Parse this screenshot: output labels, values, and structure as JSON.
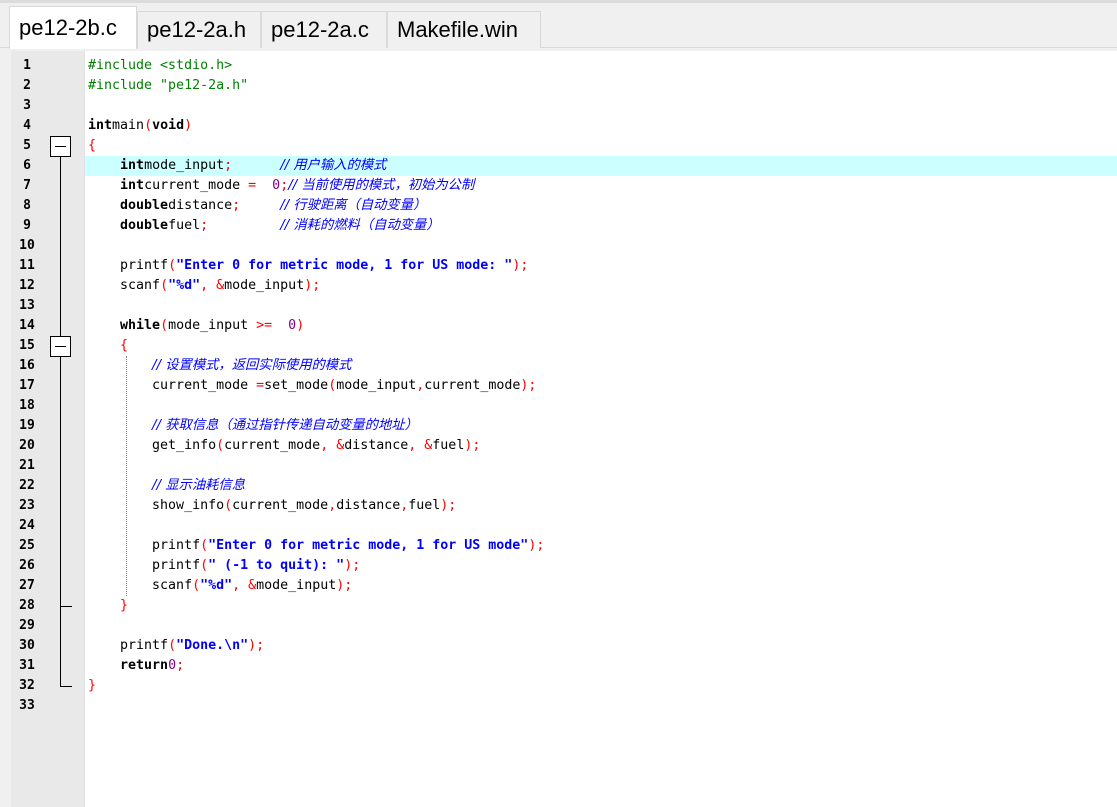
{
  "tabs": [
    {
      "label": "pe12-2b.c",
      "active": true
    },
    {
      "label": "pe12-2a.h",
      "active": false
    },
    {
      "label": "pe12-2a.c",
      "active": false
    },
    {
      "label": "Makefile.win",
      "active": false
    }
  ],
  "editor": {
    "current_line": 6,
    "fold_markers": [
      5,
      15
    ],
    "lines": [
      [
        [
          "pp",
          "#include <stdio.h>"
        ]
      ],
      [
        [
          "pp",
          "#include \"pe12-2a.h\""
        ]
      ],
      [],
      [
        [
          "kw",
          "int"
        ],
        [
          "",
          "main"
        ],
        [
          "sym",
          "("
        ],
        [
          "kw",
          "void"
        ],
        [
          "sym",
          ")"
        ]
      ],
      [
        [
          "sym",
          "{"
        ]
      ],
      [
        [
          "",
          "    "
        ],
        [
          "kw",
          "int"
        ],
        [
          "",
          "mode_input"
        ],
        [
          "sym",
          ";"
        ],
        [
          "",
          "      "
        ],
        [
          "cm",
          "// 用户输入的模式"
        ]
      ],
      [
        [
          "",
          "    "
        ],
        [
          "kw",
          "int"
        ],
        [
          "",
          "current_mode "
        ],
        [
          "sym",
          "="
        ],
        [
          "",
          "  "
        ],
        [
          "num",
          "0"
        ],
        [
          "sym",
          ";"
        ],
        [
          "",
          ""
        ],
        [
          "cm",
          "// 当前使用的模式，初始为公制"
        ]
      ],
      [
        [
          "",
          "    "
        ],
        [
          "kw",
          "double"
        ],
        [
          "",
          "distance"
        ],
        [
          "sym",
          ";"
        ],
        [
          "",
          "     "
        ],
        [
          "cm",
          "// 行驶距离（自动变量）"
        ]
      ],
      [
        [
          "",
          "    "
        ],
        [
          "kw",
          "double"
        ],
        [
          "",
          "fuel"
        ],
        [
          "sym",
          ";"
        ],
        [
          "",
          "         "
        ],
        [
          "cm",
          "// 消耗的燃料（自动变量）"
        ]
      ],
      [],
      [
        [
          "",
          "    printf"
        ],
        [
          "sym",
          "("
        ],
        [
          "str",
          "\"Enter 0 for metric mode, 1 for US mode: \""
        ],
        [
          "sym",
          ");"
        ]
      ],
      [
        [
          "",
          "    scanf"
        ],
        [
          "sym",
          "("
        ],
        [
          "str",
          "\"%d\""
        ],
        [
          "sym",
          ", &"
        ],
        [
          "",
          "mode_input"
        ],
        [
          "sym",
          ");"
        ]
      ],
      [],
      [
        [
          "",
          "    "
        ],
        [
          "kw",
          "while"
        ],
        [
          "",
          ""
        ],
        [
          "sym",
          "("
        ],
        [
          "",
          "mode_input "
        ],
        [
          "sym",
          ">="
        ],
        [
          "",
          "  "
        ],
        [
          "num",
          "0"
        ],
        [
          "sym",
          ")"
        ]
      ],
      [
        [
          "",
          "    "
        ],
        [
          "sym",
          "{"
        ]
      ],
      [
        [
          "",
          "        "
        ],
        [
          "cm",
          "// 设置模式，返回实际使用的模式"
        ]
      ],
      [
        [
          "",
          "        current_mode "
        ],
        [
          "sym",
          "="
        ],
        [
          "",
          ""
        ],
        [
          "",
          "set_mode"
        ],
        [
          "sym",
          "("
        ],
        [
          "",
          "mode_input"
        ],
        [
          "sym",
          ","
        ],
        [
          "",
          "current_mode"
        ],
        [
          "sym",
          ");"
        ]
      ],
      [],
      [
        [
          "",
          "        "
        ],
        [
          "cm",
          "// 获取信息（通过指针传递自动变量的地址）"
        ]
      ],
      [
        [
          "",
          "        get_info"
        ],
        [
          "sym",
          "("
        ],
        [
          "",
          "current_mode"
        ],
        [
          "sym",
          ", &"
        ],
        [
          "",
          "distance"
        ],
        [
          "sym",
          ", &"
        ],
        [
          "",
          "fuel"
        ],
        [
          "sym",
          ");"
        ]
      ],
      [],
      [
        [
          "",
          "        "
        ],
        [
          "cm",
          "// 显示油耗信息"
        ]
      ],
      [
        [
          "",
          "        show_info"
        ],
        [
          "sym",
          "("
        ],
        [
          "",
          "current_mode"
        ],
        [
          "sym",
          ","
        ],
        [
          "",
          "distance"
        ],
        [
          "sym",
          ","
        ],
        [
          "",
          "fuel"
        ],
        [
          "sym",
          ");"
        ]
      ],
      [],
      [
        [
          "",
          "        printf"
        ],
        [
          "sym",
          "("
        ],
        [
          "str",
          "\"Enter 0 for metric mode, 1 for US mode\""
        ],
        [
          "sym",
          ");"
        ]
      ],
      [
        [
          "",
          "        printf"
        ],
        [
          "sym",
          "("
        ],
        [
          "str",
          "\" (-1 to quit): \""
        ],
        [
          "sym",
          ");"
        ]
      ],
      [
        [
          "",
          "        scanf"
        ],
        [
          "sym",
          "("
        ],
        [
          "str",
          "\"%d\""
        ],
        [
          "sym",
          ", &"
        ],
        [
          "",
          "mode_input"
        ],
        [
          "sym",
          ");"
        ]
      ],
      [
        [
          "",
          "    "
        ],
        [
          "sym",
          "}"
        ]
      ],
      [],
      [
        [
          "",
          "    printf"
        ],
        [
          "sym",
          "("
        ],
        [
          "str",
          "\"Done.\\n\""
        ],
        [
          "sym",
          ");"
        ]
      ],
      [
        [
          "",
          "    "
        ],
        [
          "kw",
          "return"
        ],
        [
          "",
          ""
        ],
        [
          "num",
          "0"
        ],
        [
          "sym",
          ";"
        ]
      ],
      [
        [
          "sym",
          "}"
        ]
      ],
      []
    ]
  }
}
